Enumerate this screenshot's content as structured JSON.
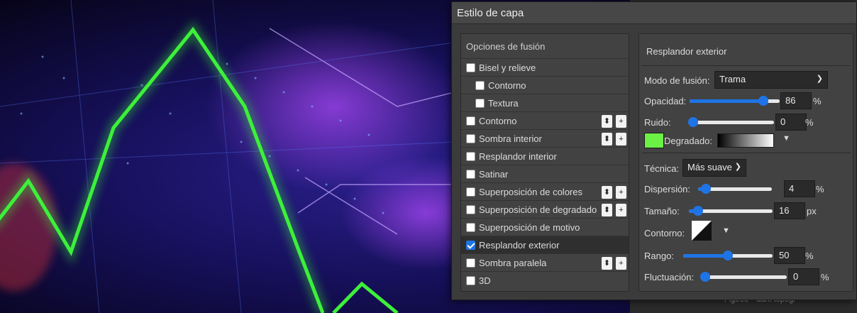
{
  "dialog": {
    "title": "Estilo de capa"
  },
  "styles": {
    "header": "Opciones de fusión",
    "items": [
      {
        "label": "Bisel y relieve",
        "checked": false,
        "indent": false,
        "buttons": false
      },
      {
        "label": "Contorno",
        "checked": false,
        "indent": true,
        "buttons": false
      },
      {
        "label": "Textura",
        "checked": false,
        "indent": true,
        "buttons": false
      },
      {
        "label": "Contorno",
        "checked": false,
        "indent": false,
        "buttons": true
      },
      {
        "label": "Sombra interior",
        "checked": false,
        "indent": false,
        "buttons": true
      },
      {
        "label": "Resplandor interior",
        "checked": false,
        "indent": false,
        "buttons": false
      },
      {
        "label": "Satinar",
        "checked": false,
        "indent": false,
        "buttons": false
      },
      {
        "label": "Superposición de colores",
        "checked": false,
        "indent": false,
        "buttons": true
      },
      {
        "label": "Superposición de degradado",
        "checked": false,
        "indent": false,
        "buttons": true
      },
      {
        "label": "Superposición de motivo",
        "checked": false,
        "indent": false,
        "buttons": false
      },
      {
        "label": "Resplandor exterior",
        "checked": true,
        "indent": false,
        "buttons": false
      },
      {
        "label": "Sombra paralela",
        "checked": false,
        "indent": false,
        "buttons": true
      },
      {
        "label": "3D",
        "checked": false,
        "indent": false,
        "buttons": false
      }
    ],
    "reorder_glyph": "⬍",
    "add_glyph": "+"
  },
  "outer_glow": {
    "title": "Resplandor exterior",
    "blend_mode": {
      "label": "Modo de fusión:",
      "value": "Trama"
    },
    "opacity": {
      "label": "Opacidad:",
      "value": "86",
      "unit": "%",
      "fraction": 0.86
    },
    "noise": {
      "label": "Ruido:",
      "value": "0",
      "unit": "%",
      "fraction": 0.0
    },
    "gradient": {
      "label": "Degradado:",
      "swatch_color": "#6cf244"
    },
    "technique": {
      "label": "Técnica:",
      "value": "Más suave"
    },
    "spread": {
      "label": "Dispersión:",
      "value": "4",
      "unit": "%",
      "fraction": 0.04
    },
    "size": {
      "label": "Tamaño:",
      "value": "16",
      "unit": "px",
      "fraction": 0.06
    },
    "contour": {
      "label": "Contorno:"
    },
    "range": {
      "label": "Rango:",
      "value": "50",
      "unit": "%",
      "fraction": 0.5
    },
    "jitter": {
      "label": "Fluctuación:",
      "value": "0",
      "unit": "%",
      "fraction": 0.0
    },
    "dropdown_glyph": "▼"
  },
  "background_layer": {
    "text": "—Figtree—dark topogr"
  },
  "colors": {
    "accent": "#1e74e6",
    "glow_line": "#3df03a"
  }
}
